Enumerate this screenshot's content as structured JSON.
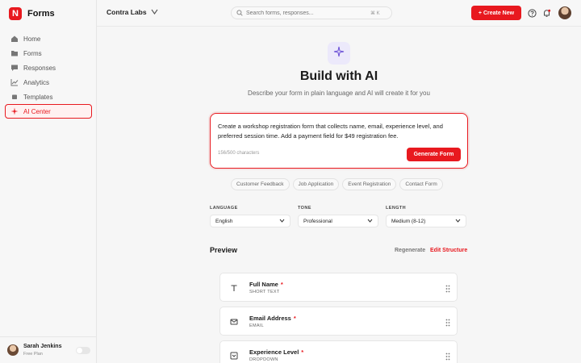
{
  "brand": {
    "logo_letter": "N",
    "name": "Forms",
    "accent": "#e8191f"
  },
  "sidebar": {
    "items": [
      {
        "label": "Home",
        "icon": "home-icon"
      },
      {
        "label": "Forms",
        "icon": "folder-icon"
      },
      {
        "label": "Responses",
        "icon": "chat-icon"
      },
      {
        "label": "Analytics",
        "icon": "chart-icon"
      },
      {
        "label": "Templates",
        "icon": "template-icon"
      },
      {
        "label": "AI Center",
        "icon": "sparkle-icon",
        "active": true
      }
    ],
    "user": {
      "name": "Sarah Jenkins",
      "plan": "Free Plan"
    }
  },
  "topbar": {
    "workspace": "Contra Labs",
    "search_placeholder": "Search forms, responses...",
    "shortcut": "⌘ K",
    "create_label": "+ Create New"
  },
  "main": {
    "title": "Build with AI",
    "subtitle": "Describe your form in plain language and AI will create it for you",
    "prompt": "Create a workshop registration form that collects name, email, experience level, and preferred session time. Add a payment field for $49 registration fee.",
    "char_count": "156/500 characters",
    "generate_label": "Generate Form",
    "chips": [
      "Customer Feedback",
      "Job Application",
      "Event Registration",
      "Contact Form"
    ],
    "options": [
      {
        "label": "LANGUAGE",
        "value": "English"
      },
      {
        "label": "TONE",
        "value": "Professional"
      },
      {
        "label": "LENGTH",
        "value": "Medium (8-12)"
      }
    ],
    "preview": {
      "title": "Preview",
      "regenerate_label": "Regenerate",
      "edit_label": "Edit Structure",
      "questions": [
        {
          "title": "Full Name",
          "required": "*",
          "type": "SHORT TEXT",
          "icon": "text-icon"
        },
        {
          "title": "Email Address",
          "required": "*",
          "type": "EMAIL",
          "icon": "mail-icon"
        },
        {
          "title": "Experience Level",
          "required": "*",
          "type": "DROPDOWN",
          "icon": "dropdown-icon"
        }
      ]
    }
  }
}
